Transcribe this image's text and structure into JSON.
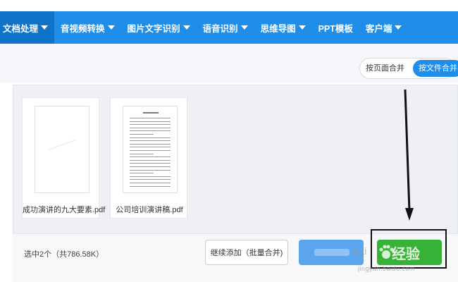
{
  "nav": {
    "items": [
      {
        "label": "文档处理",
        "dropdown": true,
        "active": true
      },
      {
        "label": "音视频转换",
        "dropdown": true
      },
      {
        "label": "图片文字识别",
        "dropdown": true
      },
      {
        "label": "语音识别",
        "dropdown": true
      },
      {
        "label": "思维导图",
        "dropdown": true
      },
      {
        "label": "PPT模板",
        "dropdown": false
      },
      {
        "label": "客户端",
        "dropdown": true
      }
    ]
  },
  "merge_modes": [
    {
      "label": "按页面合并",
      "selected": false
    },
    {
      "label": "按文件合并",
      "selected": true
    }
  ],
  "files": [
    {
      "name": "成功演讲的九大要素.pdf",
      "thumbnail": "blank-page"
    },
    {
      "name": "公司培训演讲稿.pdf",
      "thumbnail": "text-page"
    }
  ],
  "footer": {
    "count_text": "选中2个（共786.58K）",
    "add_more_label": "继续添加（批量合并)"
  },
  "watermark": {
    "main": "经验",
    "brand": "Bai",
    "url": "jingyan.baidu.com"
  },
  "colors": {
    "nav_bg": "#1e8ee8",
    "nav_active": "#0f74c8",
    "primary_blue": "#1e8ee8",
    "merge_button": "#36b336"
  }
}
